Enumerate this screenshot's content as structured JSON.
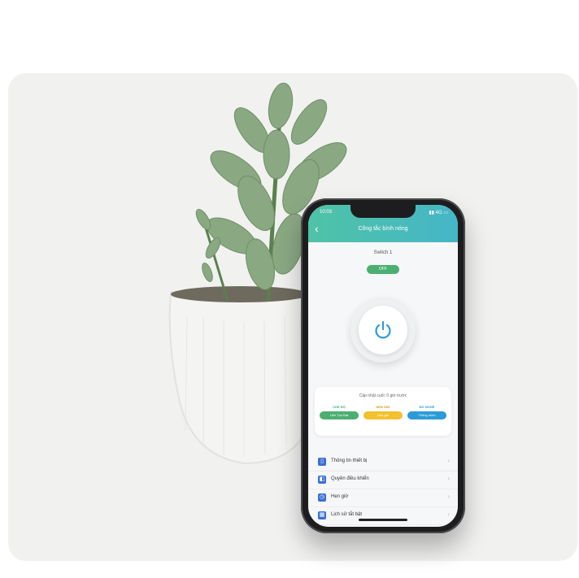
{
  "app": {
    "status_time": "10:03",
    "status_icons": "▮▮ 4G ▭",
    "title": "Công tắc bình nóng",
    "back_icon": "chevron-left-icon"
  },
  "device": {
    "name": "Switch 1",
    "state": "OFF"
  },
  "power_button": {
    "icon": "power-icon",
    "color": "#2c9bd8"
  },
  "modes": {
    "title": "Cập nhật cuối: 0 giờ trước",
    "items": [
      {
        "label": "CHẾ ĐỘ",
        "value": "Liên Tục Đạt",
        "color": "#4caf72"
      },
      {
        "label": "HẸN GIỜ",
        "value": "Hẹn giờ",
        "color": "#f2c12e"
      },
      {
        "label": "ĐỒ NGHỀ",
        "value": "Thông minh",
        "color": "#2c9bd8"
      }
    ]
  },
  "menu": [
    {
      "label": "Thông tin thiết bị",
      "icon": "device-icon",
      "color": "#3b6fd6"
    },
    {
      "label": "Quyền điều khiển",
      "icon": "control-icon",
      "color": "#3b6fd6"
    },
    {
      "label": "Hẹn giờ",
      "icon": "timer-icon",
      "color": "#3b6fd6"
    },
    {
      "label": "Lịch sử tắt bật",
      "icon": "calendar-icon",
      "color": "#3b6fd6"
    }
  ]
}
